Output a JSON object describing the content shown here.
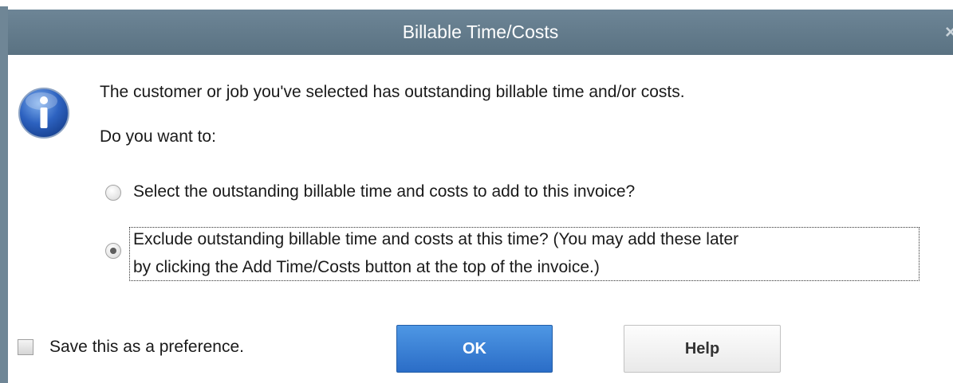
{
  "window": {
    "title": "Billable Time/Costs",
    "close_glyph": "×"
  },
  "message": {
    "line1": "The customer or job you've selected has outstanding billable time and/or costs.",
    "line2": "Do you want to:"
  },
  "options": [
    {
      "label": "Select the outstanding billable time and costs to add to this invoice?",
      "selected": false
    },
    {
      "label_line1": "Exclude outstanding billable time and costs at this time? (You may add these later",
      "label_line2": "by clicking the Add Time/Costs button at the top of the invoice.)",
      "selected": true
    }
  ],
  "preference": {
    "label": "Save this as a preference.",
    "checked": false
  },
  "buttons": {
    "ok_label": "OK",
    "help_label": "Help"
  },
  "icons": {
    "info": "info-icon"
  },
  "colors": {
    "titlebar": "#6d8596",
    "ok_button": "#2b6dc7",
    "info_icon": "#1f4fa8"
  }
}
